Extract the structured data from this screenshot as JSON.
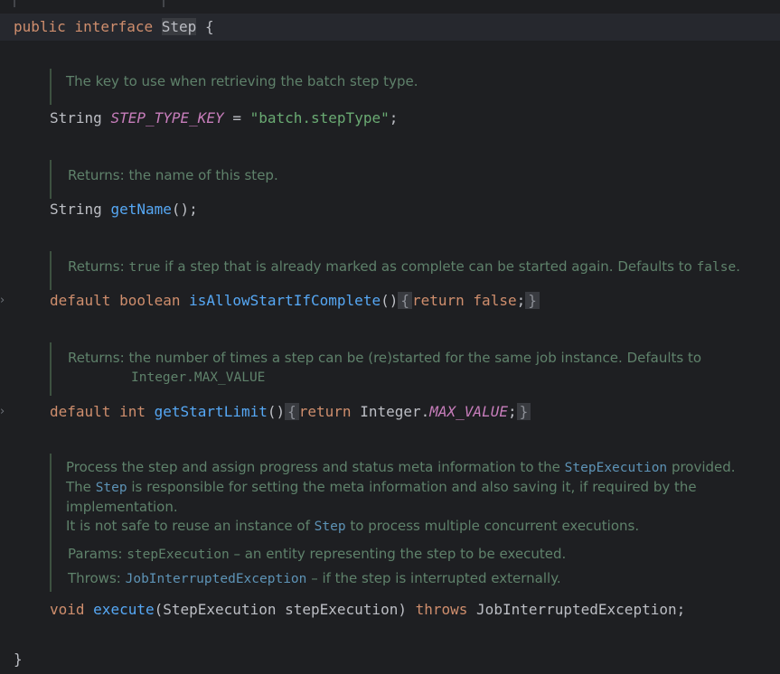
{
  "header": {
    "kw_public": "public",
    "kw_interface": "interface",
    "name": "Step",
    "brace": "{"
  },
  "doc1": {
    "text": "The key to use when retrieving the batch step type."
  },
  "line1": {
    "type": "String",
    "const": "STEP_TYPE_KEY",
    "eq": "=",
    "value": "\"batch.stepType\"",
    "semi": ";"
  },
  "doc2": {
    "label": "Returns:",
    "text": "the name of this step."
  },
  "line2": {
    "type": "String",
    "method": "getName",
    "rest": "();"
  },
  "doc3": {
    "label": "Returns:",
    "code1": "true",
    "text": "if a step that is already marked as complete can be started again. Defaults to",
    "code2": "false",
    "end": "."
  },
  "line3": {
    "kw_default": "default",
    "kw_type": "boolean",
    "method": "isAllowStartIfComplete",
    "parens": "()",
    "open": "{",
    "kw_return": "return",
    "kw_value": "false",
    "semi": ";",
    "close": "}"
  },
  "doc4": {
    "label": "Returns:",
    "text": "the number of times a step can be (re)started for the same job instance. Defaults to",
    "code": "Integer.MAX_VALUE"
  },
  "line4": {
    "kw_default": "default",
    "kw_type": "int",
    "method": "getStartLimit",
    "parens": "()",
    "open": "{",
    "kw_return": "return",
    "cls": "Integer.",
    "const": "MAX_VALUE",
    "semi": ";",
    "close": "}"
  },
  "doc5": {
    "p1a": "Process the step and assign progress and status meta information to the",
    "p1link": "StepExecution",
    "p1b": "provided.",
    "p2a": "The",
    "p2link": "Step",
    "p2b": "is responsible for setting the meta information and also saving it, if required by the",
    "p2c": "implementation.",
    "p3a": "It is not safe to reuse an instance of",
    "p3link": "Step",
    "p3b": "to process multiple concurrent executions.",
    "params_label": "Params:",
    "params_code": "stepExecution",
    "params_text": "– an entity representing the step to be executed.",
    "throws_label": "Throws:",
    "throws_link": "JobInterruptedException",
    "throws_text": "– if the step is interrupted externally."
  },
  "line5": {
    "kw_void": "void",
    "method": "execute",
    "args": "(StepExecution stepExecution)",
    "kw_throws": "throws",
    "exc": "JobInterruptedException;"
  },
  "footer": {
    "brace": "}"
  },
  "gutter": {
    "fold_icon": "chevron-right-icon"
  }
}
